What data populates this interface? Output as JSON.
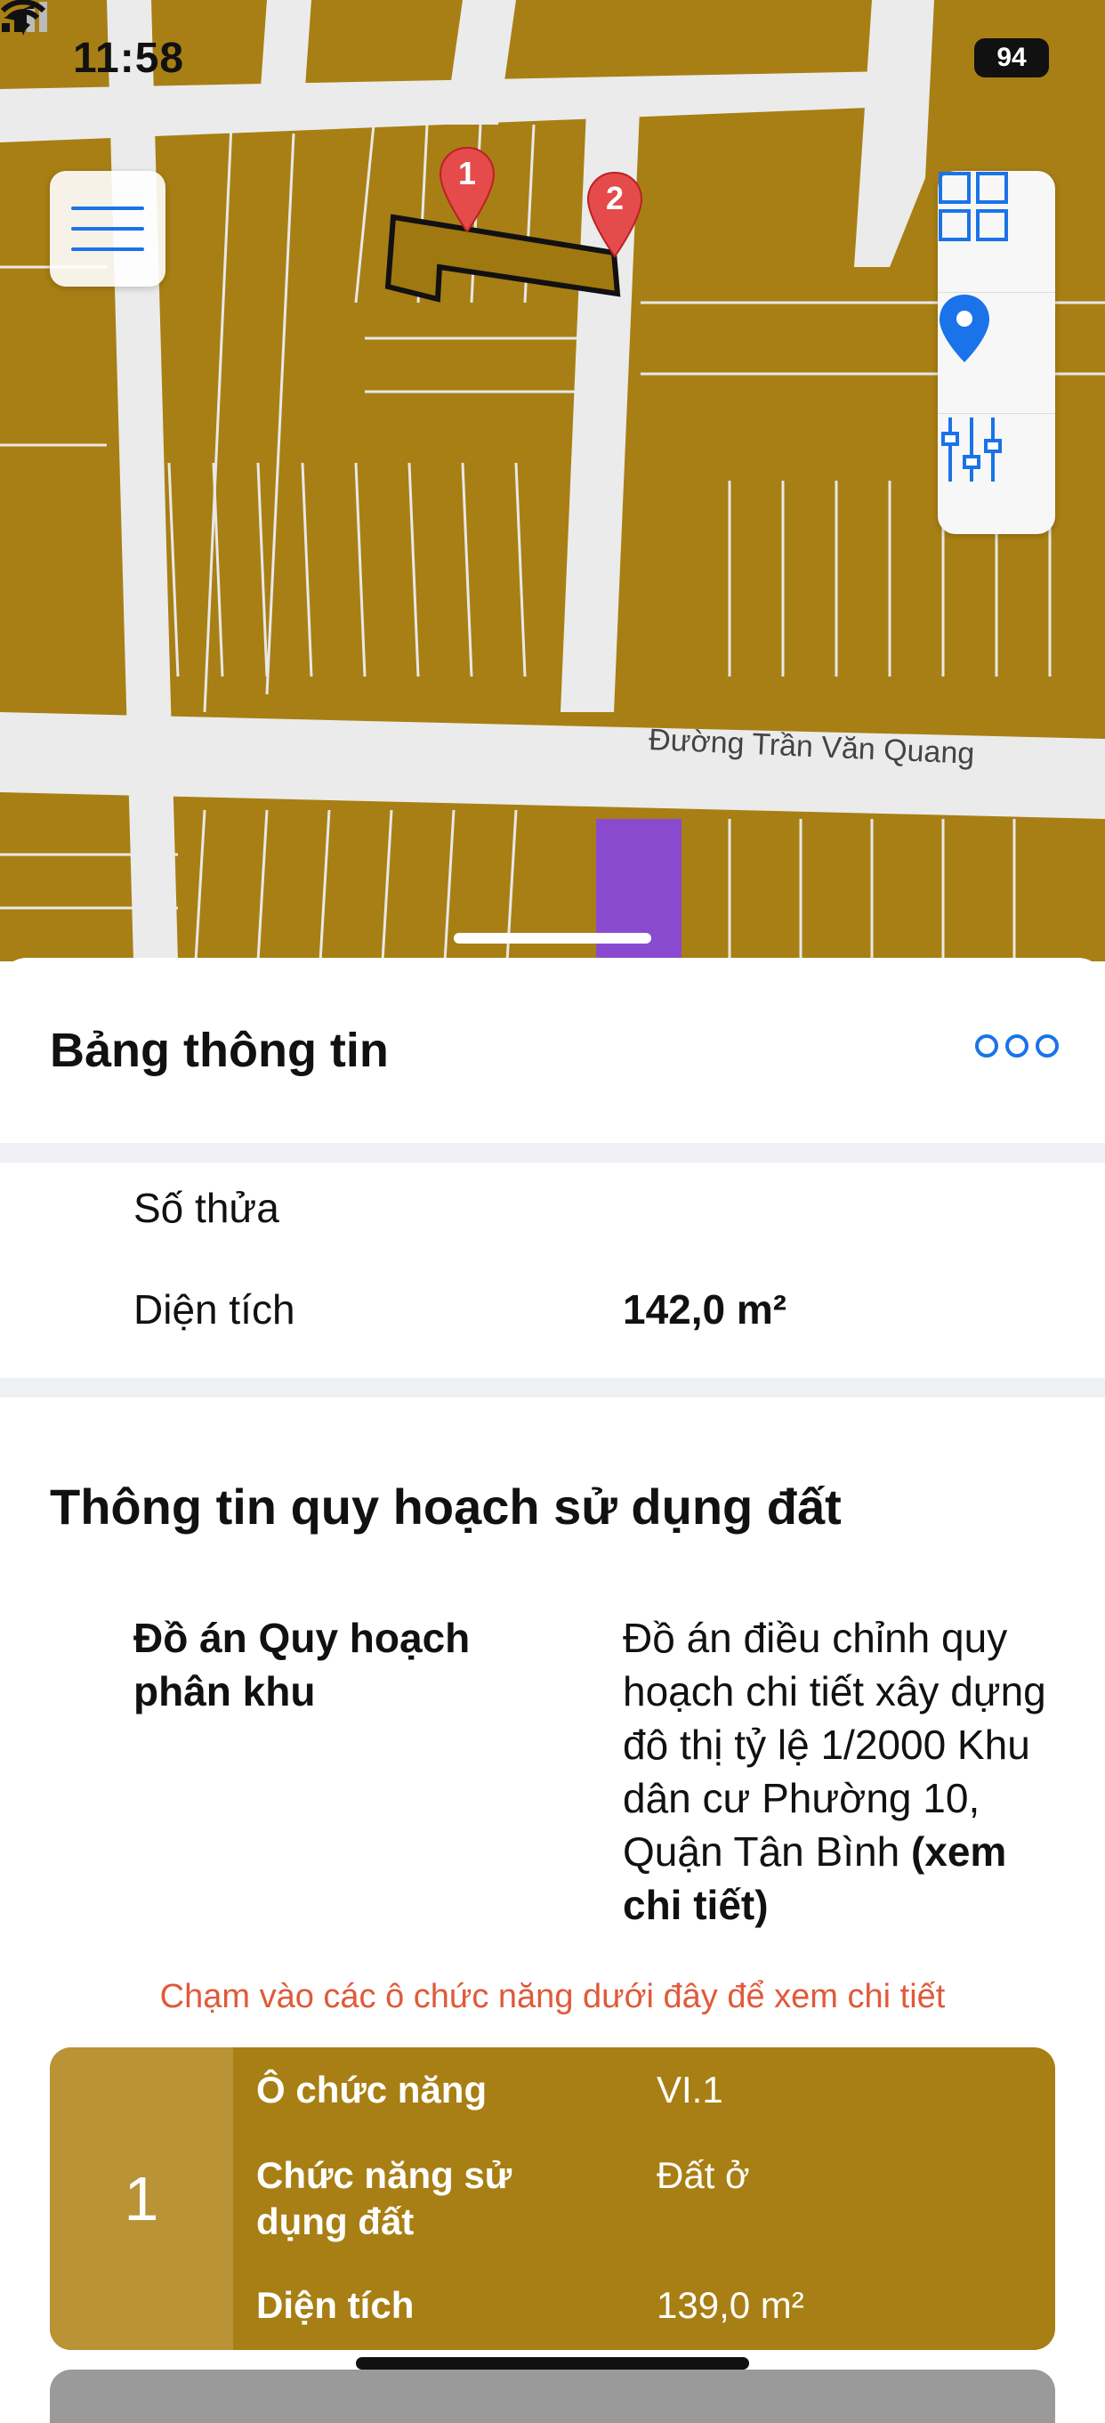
{
  "status_bar": {
    "time": "11:58",
    "battery": "94"
  },
  "map": {
    "street_label": "Đường Trần Văn Quang",
    "markers": [
      {
        "label": "1"
      },
      {
        "label": "2"
      }
    ],
    "colors": {
      "land": "#a87f14",
      "road": "#e9e9e9",
      "purple_parcel": "#8a4ad0"
    }
  },
  "toolbar": {
    "menu_icon": "hamburger-icon",
    "tools": [
      {
        "icon": "grid-icon"
      },
      {
        "icon": "location-pin-icon"
      },
      {
        "icon": "sliders-icon"
      }
    ]
  },
  "sheet": {
    "title": "Bảng thông tin",
    "more_icon": "more-dots-icon",
    "parcel": {
      "so_thua_label": "Số thửa",
      "dien_tich_label": "Diện tích",
      "dien_tich_value": "142,0 m²"
    },
    "planning": {
      "section_title": "Thông tin quy hoạch sử dụng đất",
      "do_an_label": "Đồ án Quy hoạch phân khu",
      "do_an_value": "Đồ án điều chỉnh quy hoạch chi tiết xây dựng đô thị tỷ lệ 1/2000 Khu dân cư Phường 10, Quận Tân Bình",
      "detail_link": "(xem chi tiết)",
      "hint": "Chạm vào các ô chức năng dưới đây để xem chi tiết"
    },
    "function_cards": [
      {
        "index": "1",
        "o_chuc_nang_label": "Ô chức năng",
        "o_chuc_nang_value": "VI.1",
        "chuc_nang_label": "Chức năng sử dụng đất",
        "chuc_nang_value": "Đất ở",
        "dien_tich_label": "Diện tích",
        "dien_tich_value": "139,0 m²",
        "color": "#a87f14"
      }
    ]
  }
}
